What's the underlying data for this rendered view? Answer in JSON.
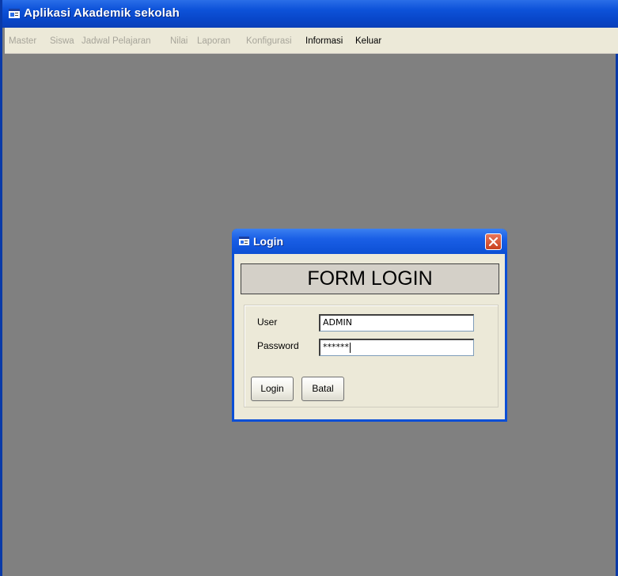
{
  "window": {
    "title": "Aplikasi Akademik sekolah",
    "icon": "app-window-icon"
  },
  "menu": {
    "items": [
      {
        "label": "Master",
        "enabled": false
      },
      {
        "label": "Siswa",
        "enabled": false
      },
      {
        "label": "Jadwal Pelajaran",
        "enabled": false
      },
      {
        "label": "Nilai",
        "enabled": false
      },
      {
        "label": "Laporan",
        "enabled": false
      },
      {
        "label": "Konfigurasi",
        "enabled": false
      },
      {
        "label": "Informasi",
        "enabled": true
      },
      {
        "label": "Keluar",
        "enabled": true
      }
    ]
  },
  "dialog": {
    "title": "Login",
    "icon": "form-icon",
    "banner": "FORM LOGIN",
    "user_label": "User",
    "user_value": "ADMIN",
    "password_label": "Password",
    "password_value": "******",
    "login_button": "Login",
    "cancel_button": "Batal"
  },
  "colors": {
    "titlebar": "#0846c9",
    "workspace": "#808080",
    "menubar": "#ece9d8",
    "disabled_text": "#a7a59a",
    "close_button": "#c9401e"
  }
}
